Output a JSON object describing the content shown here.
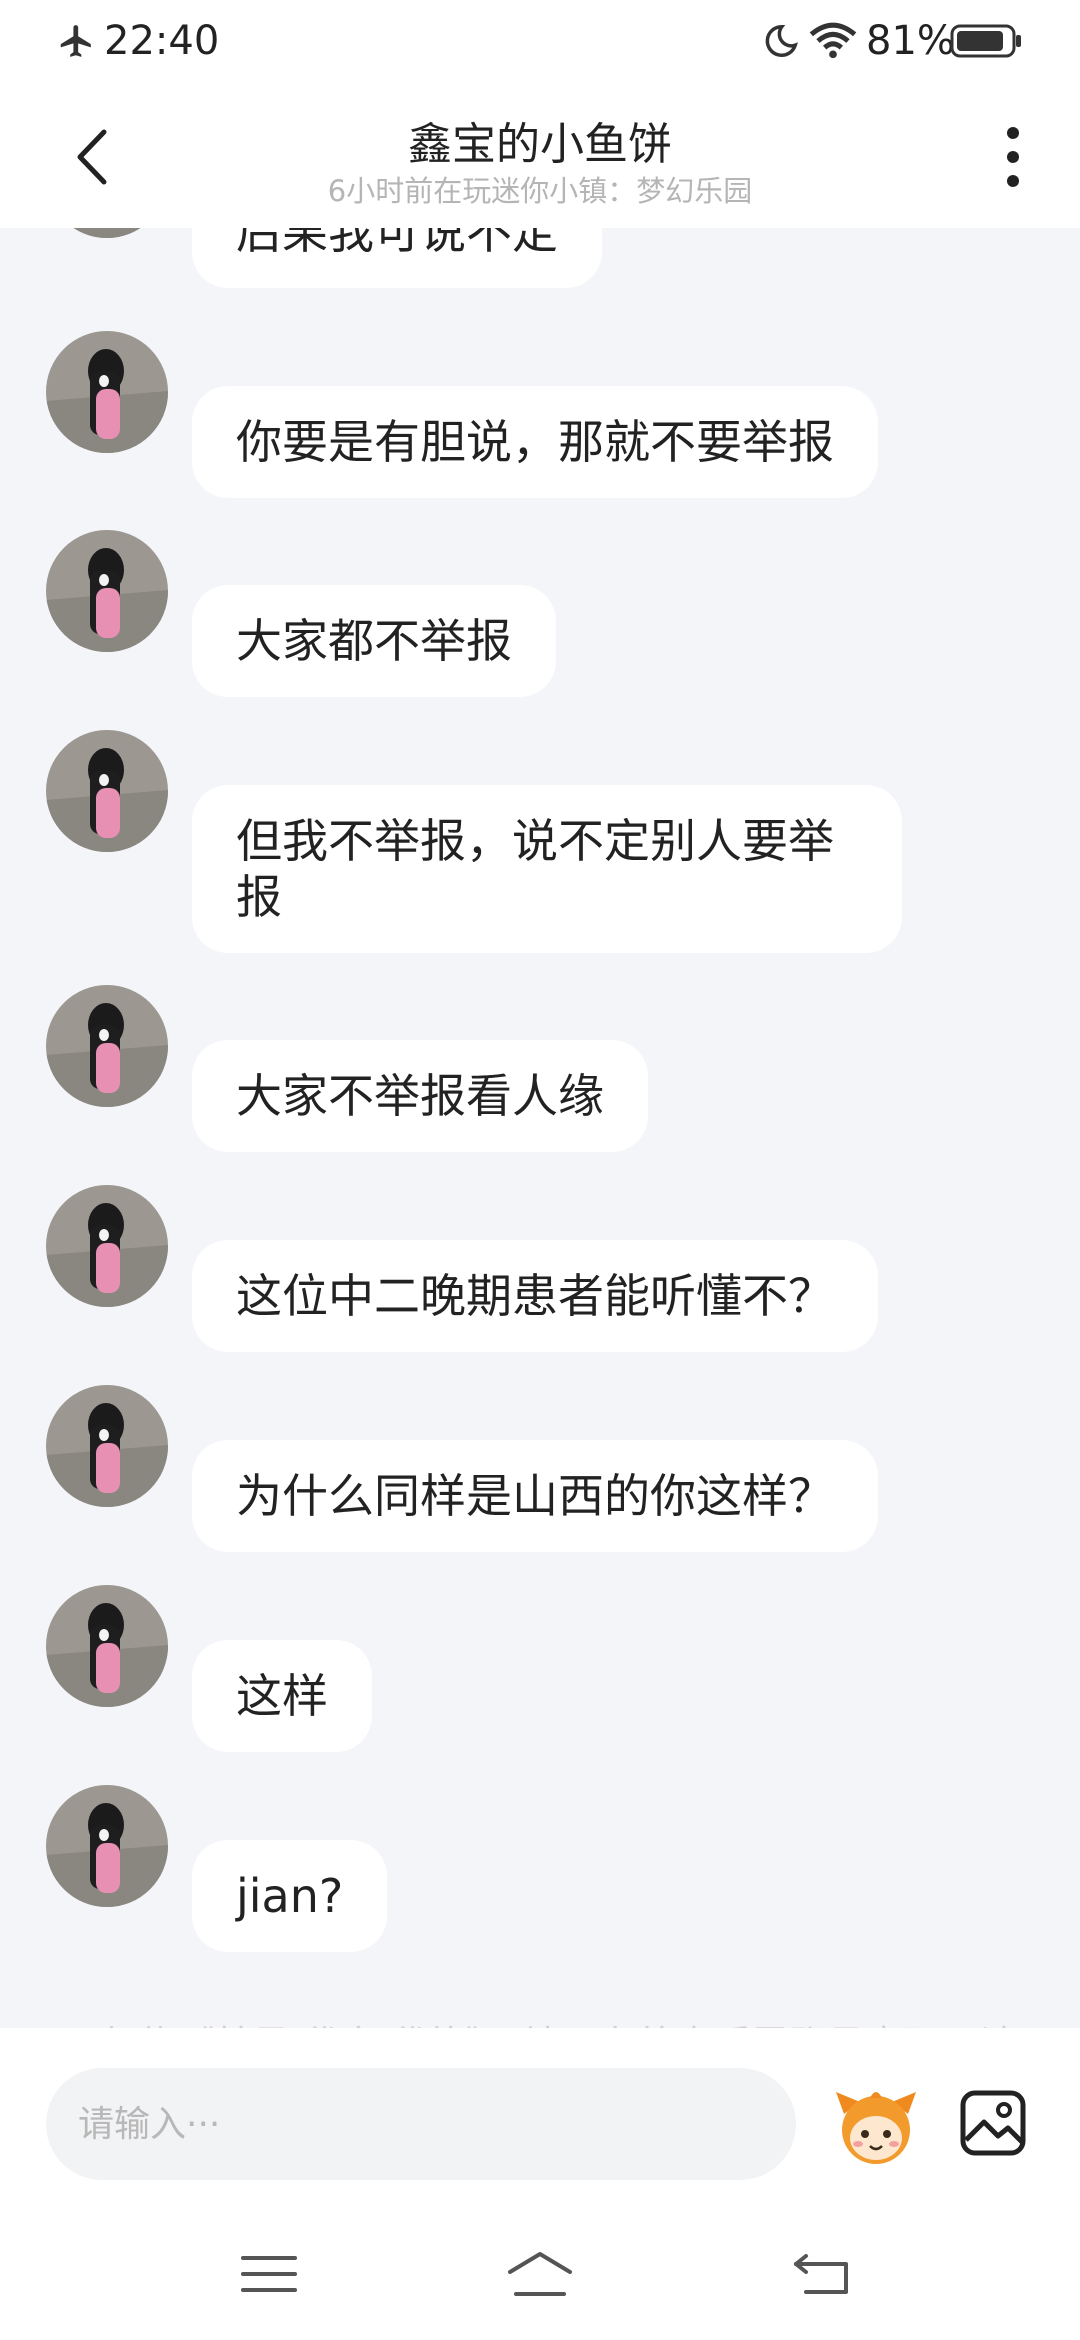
{
  "status_bar": {
    "time": "22:40",
    "battery": "81%",
    "icons": [
      "airplane-icon",
      "moon-icon",
      "wifi-icon",
      "battery-icon"
    ]
  },
  "header": {
    "title": "鑫宝的小鱼饼",
    "subtitle": "6小时前在玩迷你小镇：梦幻乐园"
  },
  "messages": [
    {
      "text": "后果我可说不定"
    },
    {
      "text": "你要是有胆说，那就不要举报"
    },
    {
      "text": "大家都不举报"
    },
    {
      "text": "但我不举报，说不定别人要举报"
    },
    {
      "text": "大家不举报看人缘"
    },
    {
      "text": "这位中二晚期患者能听懂不？"
    },
    {
      "text": "为什么同样是山西的你这样？"
    },
    {
      "text": "这样"
    },
    {
      "text": "jian?"
    }
  ],
  "partial_notice": "勿信《林号·代充·代练》，铸下在外点遥需账号密码，请",
  "input": {
    "placeholder": "请输入···"
  },
  "colors": {
    "chat_background": "#f3f5f9",
    "bubble": "#ffffff",
    "subtitle": "#b5b5b5"
  }
}
